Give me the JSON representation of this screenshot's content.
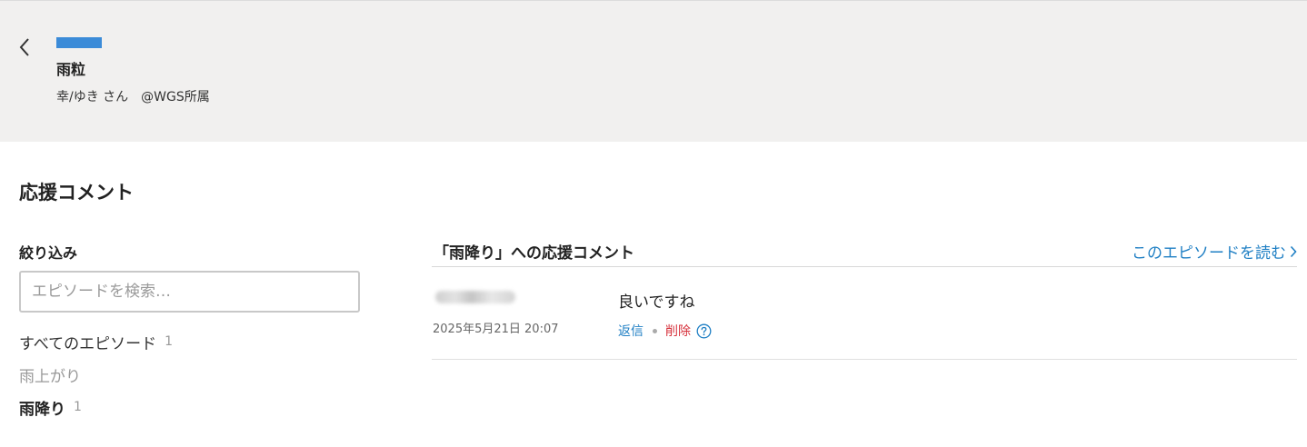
{
  "header": {
    "work_title": "雨粒",
    "author_name": "幸/ゆき さん",
    "author_affiliation": "@WGS所属",
    "color_bar": "#3b8bd8"
  },
  "page": {
    "section_title": "応援コメント"
  },
  "filter": {
    "heading": "絞り込み",
    "search_placeholder": "エピソードを検索…",
    "episodes": [
      {
        "label": "すべてのエピソード",
        "count": "1"
      },
      {
        "label": "雨上がり",
        "count": ""
      },
      {
        "label": "雨降り",
        "count": "1"
      }
    ]
  },
  "comments": {
    "heading": "「雨降り」への応援コメント",
    "read_link": "このエピソードを読む",
    "items": [
      {
        "date": "2025年5月21日 20:07",
        "body": "良いですね",
        "reply_label": "返信",
        "delete_label": "削除"
      }
    ]
  },
  "colors": {
    "link": "#1f7fc4",
    "delete": "#d6303b",
    "header_bg": "#f1f0ef"
  }
}
